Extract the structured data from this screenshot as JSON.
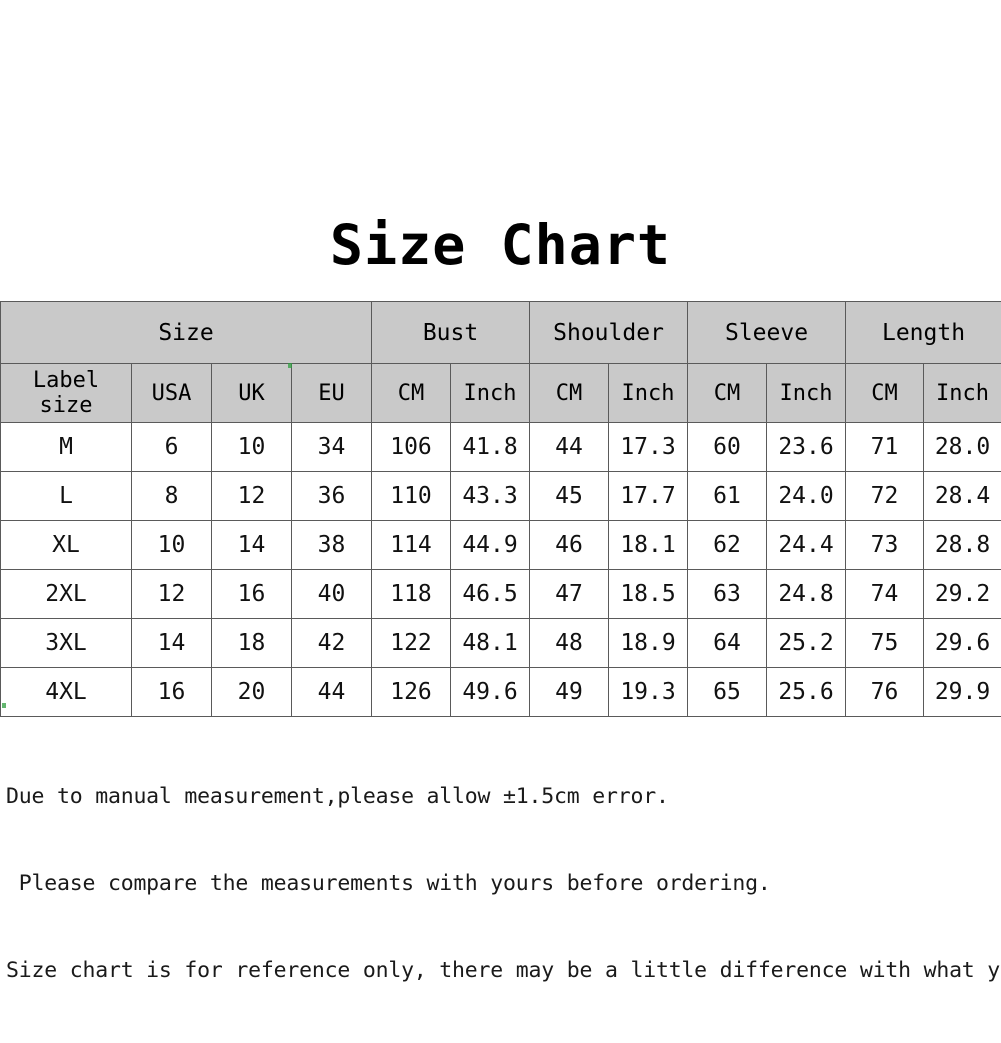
{
  "title": "Size Chart",
  "table": {
    "group_headers": [
      {
        "label": "Size",
        "span": 4
      },
      {
        "label": "Bust",
        "span": 2
      },
      {
        "label": "Shoulder",
        "span": 2
      },
      {
        "label": "Sleeve",
        "span": 2
      },
      {
        "label": "Length",
        "span": 2
      }
    ],
    "sub_headers": [
      "Label size",
      "USA",
      "UK",
      "EU",
      "CM",
      "Inch",
      "CM",
      "Inch",
      "CM",
      "Inch",
      "CM",
      "Inch"
    ],
    "rows": [
      [
        "M",
        "6",
        "10",
        "34",
        "106",
        "41.8",
        "44",
        "17.3",
        "60",
        "23.6",
        "71",
        "28.0"
      ],
      [
        "L",
        "8",
        "12",
        "36",
        "110",
        "43.3",
        "45",
        "17.7",
        "61",
        "24.0",
        "72",
        "28.4"
      ],
      [
        "XL",
        "10",
        "14",
        "38",
        "114",
        "44.9",
        "46",
        "18.1",
        "62",
        "24.4",
        "73",
        "28.8"
      ],
      [
        "2XL",
        "12",
        "16",
        "40",
        "118",
        "46.5",
        "47",
        "18.5",
        "63",
        "24.8",
        "74",
        "29.2"
      ],
      [
        "3XL",
        "14",
        "18",
        "42",
        "122",
        "48.1",
        "48",
        "18.9",
        "64",
        "25.2",
        "75",
        "29.6"
      ],
      [
        "4XL",
        "16",
        "20",
        "44",
        "126",
        "49.6",
        "49",
        "19.3",
        "65",
        "25.6",
        "76",
        "29.9"
      ]
    ]
  },
  "notes": [
    "Due to manual measurement,please allow ±1.5cm error.",
    " Please compare the measurements with yours before ordering.",
    "Size chart is for reference only, there may be a little difference with what you get."
  ],
  "colors": {
    "header_bg": "#c9c9c9",
    "body_bg": "#ffffff",
    "border": "#5a5a5a",
    "text": "#111111",
    "page_bg": "#ffffff"
  },
  "chart_data": {
    "type": "table",
    "title": "Size Chart",
    "columns": [
      "Label size",
      "USA",
      "UK",
      "EU",
      "Bust CM",
      "Bust Inch",
      "Shoulder CM",
      "Shoulder Inch",
      "Sleeve CM",
      "Sleeve Inch",
      "Length CM",
      "Length Inch"
    ],
    "column_groups": [
      {
        "name": "Size",
        "columns": [
          "Label size",
          "USA",
          "UK",
          "EU"
        ]
      },
      {
        "name": "Bust",
        "columns": [
          "CM",
          "Inch"
        ]
      },
      {
        "name": "Shoulder",
        "columns": [
          "CM",
          "Inch"
        ]
      },
      {
        "name": "Sleeve",
        "columns": [
          "CM",
          "Inch"
        ]
      },
      {
        "name": "Length",
        "columns": [
          "CM",
          "Inch"
        ]
      }
    ],
    "rows": [
      {
        "label_size": "M",
        "usa": 6,
        "uk": 10,
        "eu": 34,
        "bust_cm": 106,
        "bust_in": 41.8,
        "shoulder_cm": 44,
        "shoulder_in": 17.3,
        "sleeve_cm": 60,
        "sleeve_in": 23.6,
        "length_cm": 71,
        "length_in": 28.0
      },
      {
        "label_size": "L",
        "usa": 8,
        "uk": 12,
        "eu": 36,
        "bust_cm": 110,
        "bust_in": 43.3,
        "shoulder_cm": 45,
        "shoulder_in": 17.7,
        "sleeve_cm": 61,
        "sleeve_in": 24.0,
        "length_cm": 72,
        "length_in": 28.4
      },
      {
        "label_size": "XL",
        "usa": 10,
        "uk": 14,
        "eu": 38,
        "bust_cm": 114,
        "bust_in": 44.9,
        "shoulder_cm": 46,
        "shoulder_in": 18.1,
        "sleeve_cm": 62,
        "sleeve_in": 24.4,
        "length_cm": 73,
        "length_in": 28.8
      },
      {
        "label_size": "2XL",
        "usa": 12,
        "uk": 16,
        "eu": 40,
        "bust_cm": 118,
        "bust_in": 46.5,
        "shoulder_cm": 47,
        "shoulder_in": 18.5,
        "sleeve_cm": 63,
        "sleeve_in": 24.8,
        "length_cm": 74,
        "length_in": 29.2
      },
      {
        "label_size": "3XL",
        "usa": 14,
        "uk": 18,
        "eu": 42,
        "bust_cm": 122,
        "bust_in": 48.1,
        "shoulder_cm": 48,
        "shoulder_in": 18.9,
        "sleeve_cm": 64,
        "sleeve_in": 25.2,
        "length_cm": 75,
        "length_in": 29.6
      },
      {
        "label_size": "4XL",
        "usa": 16,
        "uk": 20,
        "eu": 44,
        "bust_cm": 126,
        "bust_in": 49.6,
        "shoulder_cm": 49,
        "shoulder_in": 19.3,
        "sleeve_cm": 65,
        "sleeve_in": 25.6,
        "length_cm": 76,
        "length_in": 29.9
      }
    ]
  }
}
